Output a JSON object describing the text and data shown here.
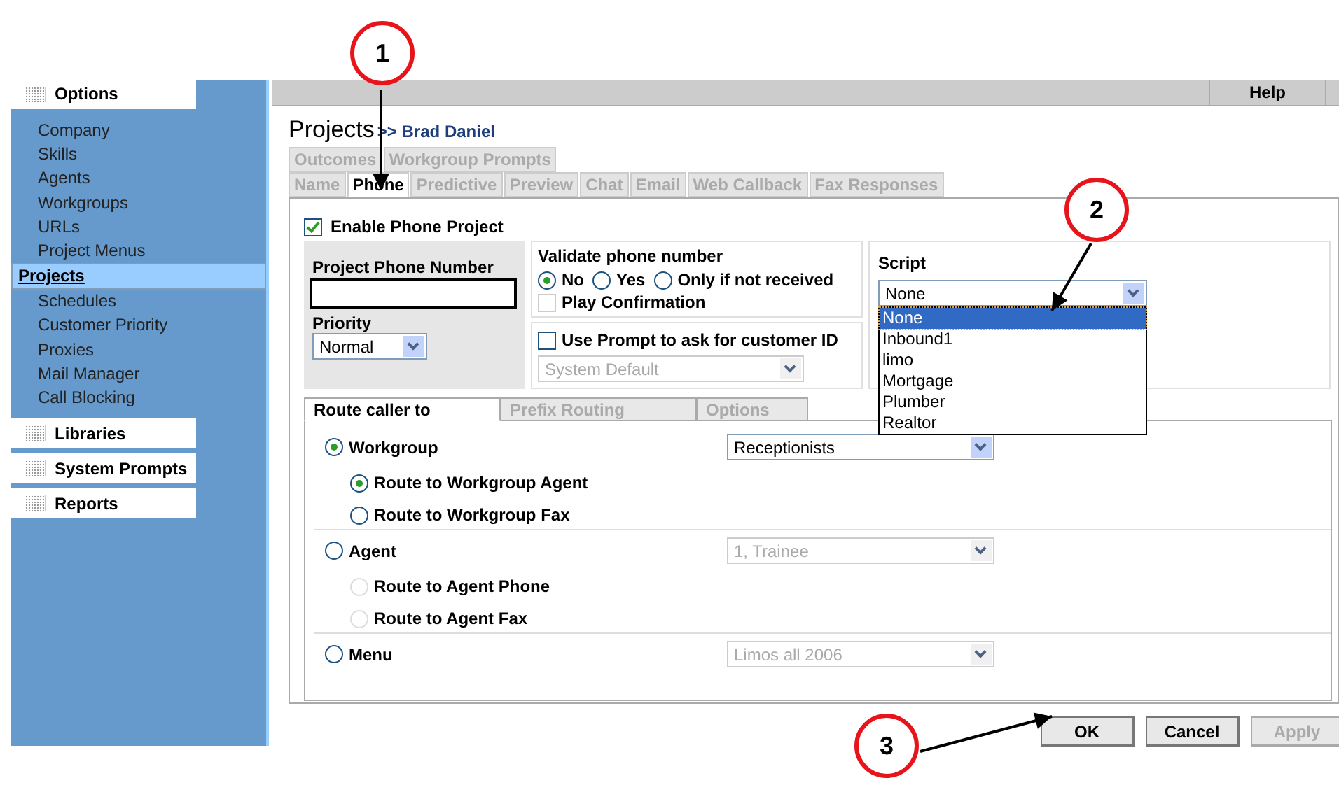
{
  "sidebar": {
    "sections": [
      {
        "title": "Options",
        "expanded": true,
        "items": [
          {
            "label": "Company",
            "selected": false
          },
          {
            "label": "Skills",
            "selected": false
          },
          {
            "label": "Agents",
            "selected": false
          },
          {
            "label": "Workgroups",
            "selected": false
          },
          {
            "label": "URLs",
            "selected": false
          },
          {
            "label": "Project Menus",
            "selected": false
          },
          {
            "label": "Projects",
            "selected": true
          },
          {
            "label": "Schedules",
            "selected": false
          },
          {
            "label": "Customer Priority",
            "selected": false
          },
          {
            "label": "Proxies",
            "selected": false
          },
          {
            "label": "Mail Manager",
            "selected": false
          },
          {
            "label": "Call Blocking",
            "selected": false
          }
        ]
      },
      {
        "title": "Libraries",
        "expanded": false
      },
      {
        "title": "System Prompts",
        "expanded": false
      },
      {
        "title": "Reports",
        "expanded": false
      }
    ]
  },
  "topbar": {
    "help": "Help"
  },
  "page": {
    "title": "Projects",
    "breadcrumb": ">> Brad Daniel"
  },
  "tabs_row1": [
    {
      "label": "Outcomes",
      "selected": false
    },
    {
      "label": "Workgroup Prompts",
      "selected": false
    }
  ],
  "tabs_row2": [
    {
      "label": "Name",
      "selected": false
    },
    {
      "label": "Phone",
      "selected": true
    },
    {
      "label": "Predictive",
      "selected": false
    },
    {
      "label": "Preview",
      "selected": false
    },
    {
      "label": "Chat",
      "selected": false
    },
    {
      "label": "Email",
      "selected": false
    },
    {
      "label": "Web Callback",
      "selected": false
    },
    {
      "label": "Fax Responses",
      "selected": false
    }
  ],
  "enable_phone_project": {
    "label": "Enable Phone Project",
    "checked": true
  },
  "phone_number": {
    "label": "Project Phone Number"
  },
  "priority": {
    "label": "Priority",
    "value": "Normal"
  },
  "validate": {
    "label": "Validate phone number",
    "options": [
      {
        "label": "No",
        "selected": true
      },
      {
        "label": "Yes",
        "selected": false
      },
      {
        "label": "Only if not received",
        "selected": false
      }
    ]
  },
  "play_confirmation": {
    "label": "Play Confirmation",
    "checked": false
  },
  "use_prompt": {
    "label": "Use Prompt to ask for customer ID",
    "checked": false
  },
  "prompt_select": {
    "value": "System Default",
    "disabled": true
  },
  "script": {
    "label": "Script",
    "value": "None",
    "expanded": true,
    "options": [
      {
        "label": "None",
        "selected": true
      },
      {
        "label": "Inbound1",
        "selected": false
      },
      {
        "label": "limo",
        "selected": false
      },
      {
        "label": "Mortgage",
        "selected": false
      },
      {
        "label": "Plumber",
        "selected": false
      },
      {
        "label": "Realtor",
        "selected": false
      }
    ]
  },
  "route_tabs": [
    {
      "label": "Route caller to",
      "selected": true
    },
    {
      "label": "Prefix Routing",
      "selected": false
    },
    {
      "label": "Options",
      "selected": false
    }
  ],
  "routes": [
    {
      "label": "Workgroup",
      "selected": true,
      "select": {
        "value": "Receptionists",
        "disabled": false
      },
      "children": [
        {
          "label": "Route to Workgroup Agent",
          "selected": true,
          "disabled": false
        },
        {
          "label": "Route to Workgroup Fax",
          "selected": false,
          "disabled": false
        }
      ]
    },
    {
      "label": "Agent",
      "selected": false,
      "select": {
        "value": "1, Trainee",
        "disabled": true
      },
      "children": [
        {
          "label": "Route to Agent Phone",
          "selected": false,
          "disabled": true
        },
        {
          "label": "Route to Agent Fax",
          "selected": false,
          "disabled": true
        }
      ]
    },
    {
      "label": "Menu",
      "selected": false,
      "select": {
        "value": "Limos all 2006",
        "disabled": true
      }
    }
  ],
  "buttons": [
    {
      "label": "OK",
      "disabled": false
    },
    {
      "label": "Cancel",
      "disabled": false
    },
    {
      "label": "Apply",
      "disabled": true
    }
  ],
  "callouts": [
    {
      "number": "1"
    },
    {
      "number": "2"
    },
    {
      "number": "3"
    }
  ]
}
